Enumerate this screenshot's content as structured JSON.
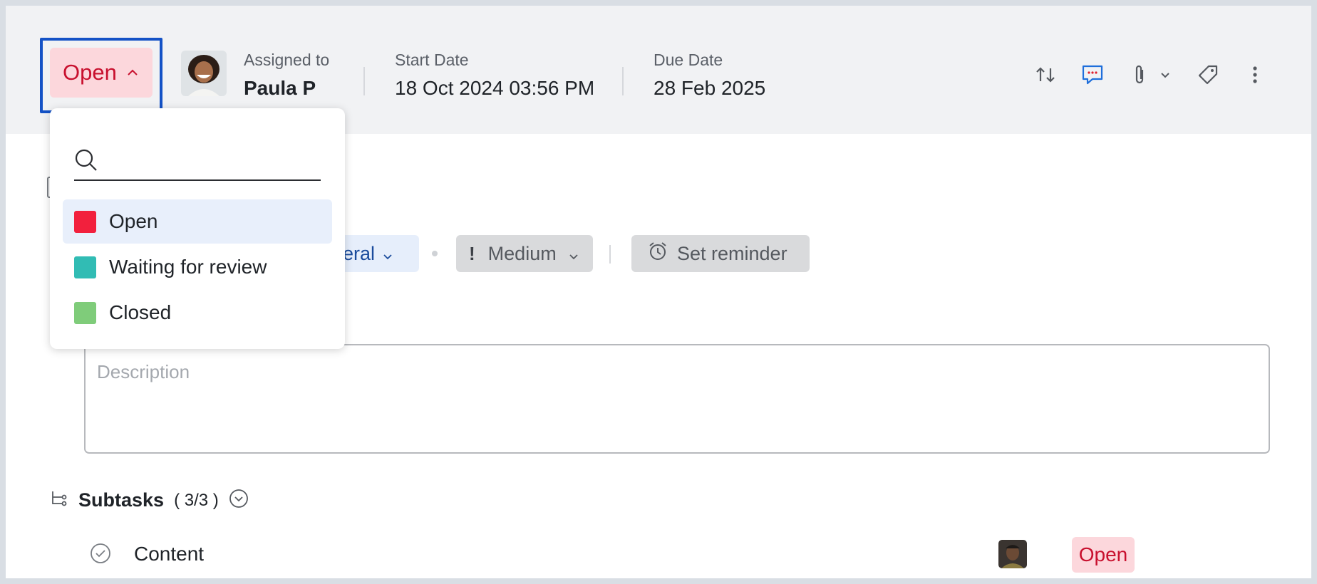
{
  "header": {
    "status_label": "Open",
    "assigned_label": "Assigned to",
    "assignee": "Paula P",
    "start_label": "Start Date",
    "start_value": "18 Oct 2024 03:56 PM",
    "due_label": "Due Date",
    "due_value": "28 Feb 2025",
    "toolbar_icons": [
      "swap-icon",
      "comment-icon",
      "attachment-icon",
      "chevron-down-icon",
      "tag-icon",
      "more-icon"
    ]
  },
  "status_dropdown": {
    "search_placeholder": "",
    "options": [
      {
        "label": "Open",
        "color": "#f2203d"
      },
      {
        "label": "Waiting for review",
        "color": "#31bcb4"
      },
      {
        "label": "Closed",
        "color": "#7fcc7a"
      }
    ],
    "selected": "Open"
  },
  "task_meta": {
    "category_fragment": "neral",
    "priority_label": "Medium",
    "reminder_label": "Set reminder"
  },
  "description": {
    "placeholder": "Description"
  },
  "subtasks": {
    "title": "Subtasks",
    "count": "( 3/3 )",
    "items": [
      {
        "label": "Content",
        "status": "Open"
      }
    ]
  },
  "colors": {
    "status_open_bg": "#fcd7dc",
    "status_open_text": "#c8102e",
    "focus_ring": "#1452c6",
    "accent_blue": "#1a4b9c"
  }
}
